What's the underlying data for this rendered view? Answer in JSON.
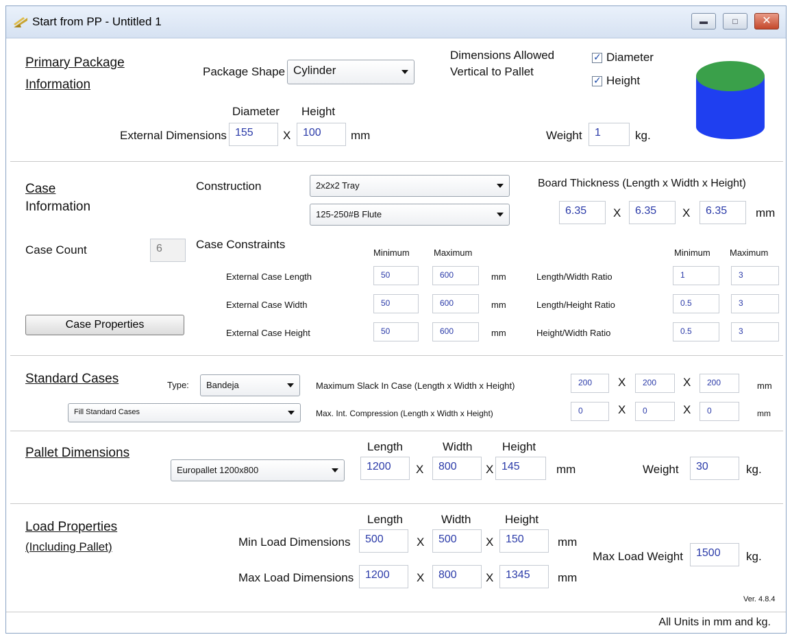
{
  "window": {
    "title": "Start from PP - Untitled 1"
  },
  "primary": {
    "header_line1": "Primary Package",
    "header_line2": "Information",
    "shape_label": "Package Shape",
    "shape_value": "Cylinder",
    "dims_allowed_line1": "Dimensions Allowed",
    "dims_allowed_line2": "Vertical to Pallet",
    "chk_diameter": "Diameter",
    "chk_height": "Height",
    "col_diameter": "Diameter",
    "col_height": "Height",
    "ext_dims_label": "External Dimensions",
    "diameter": "155",
    "height": "100",
    "x": "X",
    "unit_mm": "mm",
    "weight_label": "Weight",
    "weight": "1",
    "unit_kg": "kg.",
    "colors": {
      "cylinder_top": "#3aa04a",
      "cylinder_body": "#1f3ff0"
    }
  },
  "case": {
    "header_line1": "Case",
    "header_line2": "Information",
    "construction_label": "Construction",
    "construction_value": "2x2x2 Tray",
    "flute_value": "125-250#B Flute",
    "board_label": "Board Thickness (Length x Width x Height)",
    "board": [
      "6.35",
      "6.35",
      "6.35"
    ],
    "count_label": "Case Count",
    "count": "6",
    "constraints_label": "Case Constraints",
    "min_label": "Minimum",
    "max_label": "Maximum",
    "rows": [
      {
        "label": "External Case Length",
        "min": "50",
        "max": "600",
        "unit": "mm",
        "ratio_label": "Length/Width Ratio",
        "rmin": "1",
        "rmax": "3"
      },
      {
        "label": "External Case Width",
        "min": "50",
        "max": "600",
        "unit": "mm",
        "ratio_label": "Length/Height Ratio",
        "rmin": "0.5",
        "rmax": "3"
      },
      {
        "label": "External Case Height",
        "min": "50",
        "max": "600",
        "unit": "mm",
        "ratio_label": "Height/Width Ratio",
        "rmin": "0.5",
        "rmax": "3"
      }
    ],
    "properties_button": "Case Properties"
  },
  "standard": {
    "header": "Standard Cases",
    "type_label": "Type:",
    "type_value": "Bandeja",
    "fill_value": "Fill Standard Cases",
    "slack_label": "Maximum Slack In Case  (Length x Width x Height)",
    "slack": [
      "200",
      "200",
      "200"
    ],
    "compression_label": "Max. Int. Compression (Length x Width x Height)",
    "compression": [
      "0",
      "0",
      "0"
    ],
    "unit": "mm"
  },
  "pallet": {
    "header": "Pallet Dimensions",
    "type_value": "Europallet 1200x800",
    "col_length": "Length",
    "col_width": "Width",
    "col_height": "Height",
    "length": "1200",
    "width": "800",
    "height": "145",
    "unit": "mm",
    "weight_label": "Weight",
    "weight": "30",
    "unit_kg": "kg."
  },
  "load": {
    "header_line1": "Load Properties",
    "header_line2": "(Including Pallet)",
    "col_length": "Length",
    "col_width": "Width",
    "col_height": "Height",
    "min_label": "Min Load Dimensions",
    "min": [
      "500",
      "500",
      "150"
    ],
    "max_label": "Max Load Dimensions",
    "max": [
      "1200",
      "800",
      "1345"
    ],
    "unit": "mm",
    "max_weight_label": "Max Load Weight",
    "max_weight": "1500",
    "unit_kg": "kg.",
    "version": "Ver. 4.8.4"
  },
  "footer": {
    "units_note": "All Units in mm and kg."
  }
}
